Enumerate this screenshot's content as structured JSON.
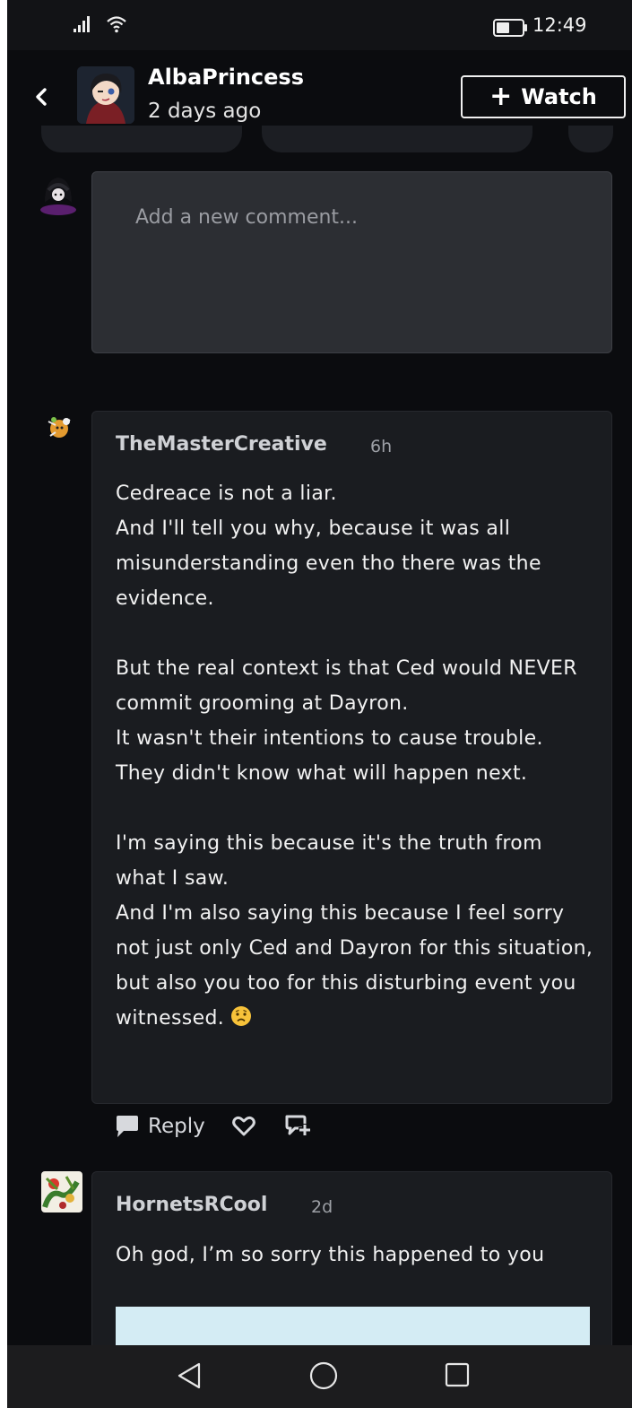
{
  "status_bar": {
    "time": "12:49"
  },
  "header": {
    "author": "AlbaPrincess",
    "post_time": "2 days ago",
    "watch_label": "Watch"
  },
  "new_comment": {
    "placeholder": "Add a new comment..."
  },
  "comments": [
    {
      "author": "TheMasterCreative",
      "time": "6h",
      "text": "Cedreace is not a liar.\nAnd I'll tell you why, because it was all misunderstanding even tho there was the evidence.\n\nBut the real context is that Ced would NEVER commit grooming at Dayron.\nIt wasn't their intentions to cause trouble.\nThey didn't know what will happen next.\n\nI'm saying this because it's the truth from what I saw.\nAnd I'm also saying this because I feel sorry not just only Ced and Dayron for this situation, but also you too for this disturbing event you witnessed.",
      "emoji": "worried-face-emoji",
      "reply_label": "Reply"
    },
    {
      "author": "HornetsRCool",
      "time": "2d",
      "text": "Oh god, I’m so sorry this happened to you"
    }
  ],
  "icons": {
    "back": "chevron-left-icon",
    "reply": "speech-bubble-icon",
    "like": "heart-icon",
    "gift": "gift-icon"
  },
  "colors": {
    "background": "#0b0c0f",
    "comment_card": "#1a1c20",
    "input_box": "#2c2e33",
    "text": "#f1f1f1",
    "muted": "#9da0a6"
  }
}
